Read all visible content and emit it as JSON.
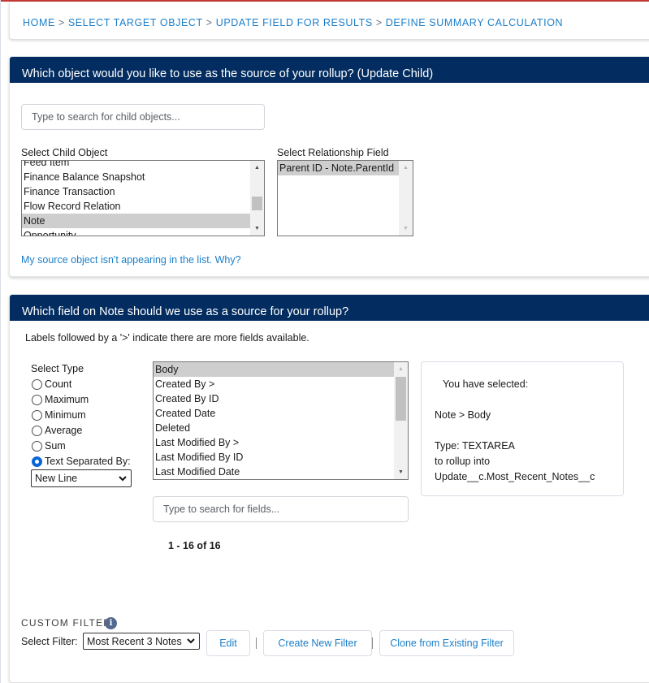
{
  "colors": {
    "accent_red": "#c23934",
    "header_navy": "#032d60",
    "link_blue": "#1b7fc9",
    "radio_blue": "#0a66d6",
    "selected_gray": "#cecece"
  },
  "breadcrumb": {
    "items": [
      "HOME",
      "SELECT TARGET OBJECT",
      "UPDATE FIELD FOR RESULTS",
      "DEFINE SUMMARY CALCULATION"
    ],
    "separator": ">"
  },
  "source_object": {
    "header": "Which object would you like to use as the source of your rollup? (Update Child)",
    "search_placeholder": "Type to search for child objects...",
    "child_object_label": "Select Child Object",
    "child_objects": [
      "Feed Item",
      "Finance Balance Snapshot",
      "Finance Transaction",
      "Flow Record Relation",
      "Note",
      "Opportunity"
    ],
    "selected_child_object": "Note",
    "relationship_label": "Select Relationship Field",
    "relationship_fields": [
      "Parent ID - Note.ParentId"
    ],
    "selected_relationship_field": "Parent ID - Note.ParentId",
    "help_link": "My source object isn't appearing in the list. Why?"
  },
  "source_field": {
    "header": "Which field on Note should we use as a source for your rollup?",
    "hint": "Labels followed by a '>' indicate there are more fields available.",
    "type_label": "Select Type",
    "types": [
      {
        "label": "Count",
        "checked": false
      },
      {
        "label": "Maximum",
        "checked": false
      },
      {
        "label": "Minimum",
        "checked": false
      },
      {
        "label": "Average",
        "checked": false
      },
      {
        "label": "Sum",
        "checked": false
      },
      {
        "label": "Text Separated By:",
        "checked": true
      }
    ],
    "separator_select": "New Line",
    "fields": [
      "Body",
      "Created By >",
      "Created By ID",
      "Created Date",
      "Deleted",
      "Last Modified By >",
      "Last Modified By ID",
      "Last Modified Date"
    ],
    "selected_field": "Body",
    "field_search_placeholder": "Type to search for fields...",
    "count_label": "1 - 16 of 16",
    "summary": {
      "title": "You have selected:",
      "path": "Note > Body",
      "type": "Type: TEXTAREA",
      "rollup_into_label": "to rollup into",
      "target": "Update__c.Most_Recent_Notes__c"
    }
  },
  "custom_filter": {
    "title": "CUSTOM FILTER",
    "info_icon": "i",
    "select_label": "Select Filter:",
    "selected_filter": "Most Recent 3 Notes",
    "edit_button": "Edit",
    "create_button": "Create New Filter",
    "clone_button": "Clone from Existing Filter"
  }
}
